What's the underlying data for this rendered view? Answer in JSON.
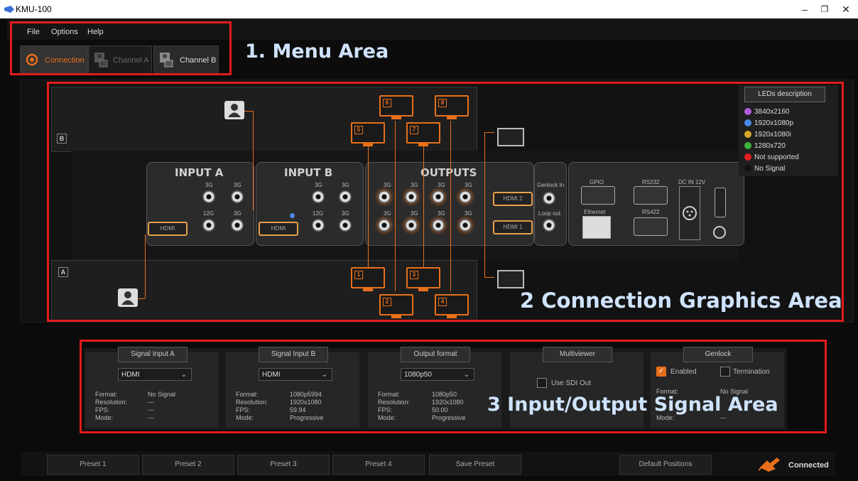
{
  "window": {
    "title": "KMU-100",
    "minimize": "–",
    "restore": "❐",
    "close": "✕"
  },
  "menu": {
    "file": "File",
    "options": "Options",
    "help": "Help"
  },
  "tabs": [
    {
      "label": "Connection",
      "active": true
    },
    {
      "label": "Channel A",
      "active": false
    },
    {
      "label": "Channel B",
      "active": false
    }
  ],
  "annotations": {
    "menu_area": "1. Menu Area",
    "graphics_area": "2 Connection Graphics Area",
    "signal_area": "3 Input/Output Signal Area"
  },
  "device": {
    "input_a": "INPUT A",
    "input_b": "INPUT B",
    "outputs": "OUTPUTS",
    "genlock_in": "Genlock In",
    "loop_out": "Loop out",
    "gpio": "GPIO",
    "rs232": "RS232",
    "dc_in": "DC IN 12V",
    "ethernet": "Ethernet",
    "rs422": "RS422",
    "hdmi": "HDMI",
    "hdmi_1": "HDMI 1",
    "hdmi_2": "HDMI 2",
    "lbl_3g": "3G",
    "lbl_12g": "12G"
  },
  "monitors": {
    "m1": "1",
    "m2": "2",
    "m3": "3",
    "m4": "4",
    "m5": "5",
    "m6": "6",
    "m7": "7",
    "m8": "8"
  },
  "leds": {
    "button": "LEDs description",
    "items": [
      {
        "label": "3840x2160",
        "color": "#b05be0"
      },
      {
        "label": "1920x1080p",
        "color": "#4a8be8"
      },
      {
        "label": "1920x1080i",
        "color": "#d4a628"
      },
      {
        "label": "1280x720",
        "color": "#3bb43b"
      },
      {
        "label": "Not supported",
        "color": "#e02020"
      },
      {
        "label": "No Signal",
        "color": "#111111"
      }
    ]
  },
  "signal": {
    "input_a": {
      "title": "Signal Input A",
      "select": "HDMI",
      "format": "No Signal",
      "resolution": "---",
      "fps": "---",
      "mode": "---"
    },
    "input_b": {
      "title": "Signal Input B",
      "select": "HDMI",
      "format": "1080p5994",
      "resolution": "1920x1080",
      "fps": "59.94",
      "mode": "Progressive"
    },
    "output": {
      "title": "Output format",
      "select": "1080p50",
      "format": "1080p50",
      "resolution": "1920x1080",
      "fps": "50.00",
      "mode": "Progressive"
    },
    "multiviewer": {
      "title": "Multiviewer",
      "use_sdi": "Use SDI Out"
    },
    "genlock": {
      "title": "Genlock",
      "enabled": "Enabled",
      "termination": "Termination",
      "format": "No Signal",
      "mode": "---"
    },
    "labels": {
      "format": "Format:",
      "resolution": "Resolution:",
      "fps": "FPS:",
      "mode": "Mode:"
    },
    "chevron": "⌄"
  },
  "footer": {
    "presets": [
      "Preset 1",
      "Preset 2",
      "Preset 3",
      "Preset 4",
      "Save Preset"
    ],
    "default_positions": "Default Positions",
    "status": "Connected"
  }
}
